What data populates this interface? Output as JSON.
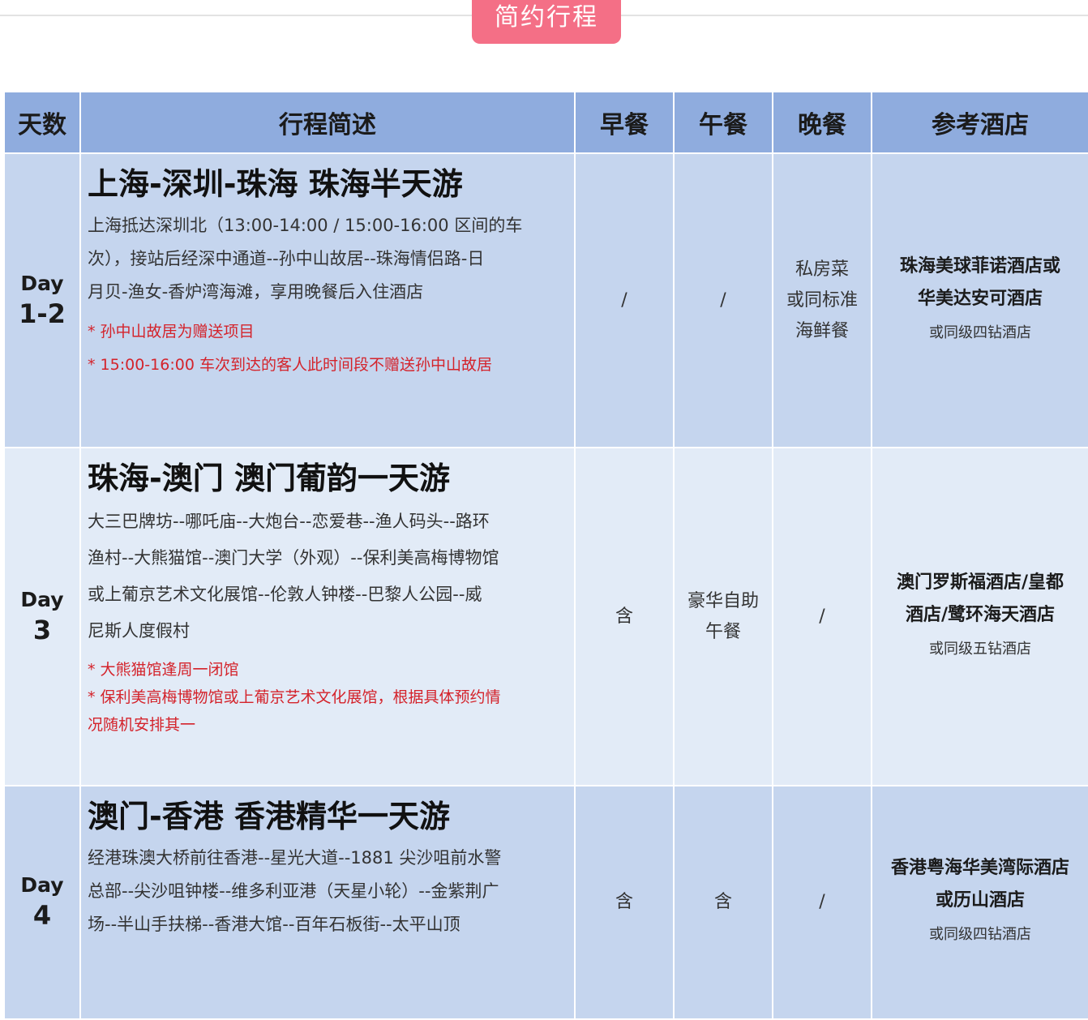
{
  "banner": "简约行程",
  "headers": [
    "天数",
    "行程简述",
    "早餐",
    "午餐",
    "晚餐",
    "参考酒店"
  ],
  "days": [
    {
      "day_label": "Day",
      "day_num": "1-2",
      "title": "上海-深圳-珠海  珠海半天游",
      "lines": [
        "上海抵达深圳北（13:00-14:00 / 15:00-16:00 区间的车",
        "次），接站后经深中通道--孙中山故居--珠海情侣路-日",
        "月贝-渔女-香炉湾海滩，享用晚餐后入住酒店"
      ],
      "notes": [
        "* 孙中山故居为赠送项目",
        "* 15:00-16:00 车次到达的客人此时间段不赠送孙中山故居"
      ],
      "breakfast": [
        "/"
      ],
      "lunch": [
        "/"
      ],
      "dinner": [
        "私房菜",
        "或同标准",
        "海鲜餐"
      ],
      "hotel": [
        "珠海美球菲诺酒店或",
        "华美达安可酒店"
      ],
      "hotel_alt": "或同级四钻酒店"
    },
    {
      "day_label": "Day",
      "day_num": "3",
      "title": "珠海-澳门  澳门葡韵一天游",
      "lines": [
        "大三巴牌坊--哪吒庙--大炮台--恋爱巷--渔人码头--路环",
        "渔村--大熊猫馆--澳门大学（外观）--保利美高梅博物馆",
        "或上葡京艺术文化展馆--伦敦人钟楼--巴黎人公园--威",
        "尼斯人度假村"
      ],
      "notes": [
        "* 大熊猫馆逢周一闭馆",
        "* 保利美高梅博物馆或上葡京艺术文化展馆，根据具体预约情",
        "况随机安排其一"
      ],
      "breakfast": [
        "含"
      ],
      "lunch": [
        "豪华自助",
        "午餐"
      ],
      "dinner": [
        "/"
      ],
      "hotel": [
        "澳门罗斯福酒店/皇都",
        "酒店/鹭环海天酒店"
      ],
      "hotel_alt": "或同级五钻酒店"
    },
    {
      "day_label": "Day",
      "day_num": "4",
      "title": "澳门-香港  香港精华一天游",
      "lines": [
        "经港珠澳大桥前往香港--星光大道--1881 尖沙咀前水警",
        "总部--尖沙咀钟楼--维多利亚港（天星小轮）--金紫荆广",
        "场--半山手扶梯--香港大馆--百年石板街--太平山顶"
      ],
      "notes": [],
      "breakfast": [
        "含"
      ],
      "lunch": [
        "含"
      ],
      "dinner": [
        "/"
      ],
      "hotel": [
        "香港粤海华美湾际酒店",
        "或历山酒店"
      ],
      "hotel_alt": "或同级四钻酒店"
    }
  ]
}
